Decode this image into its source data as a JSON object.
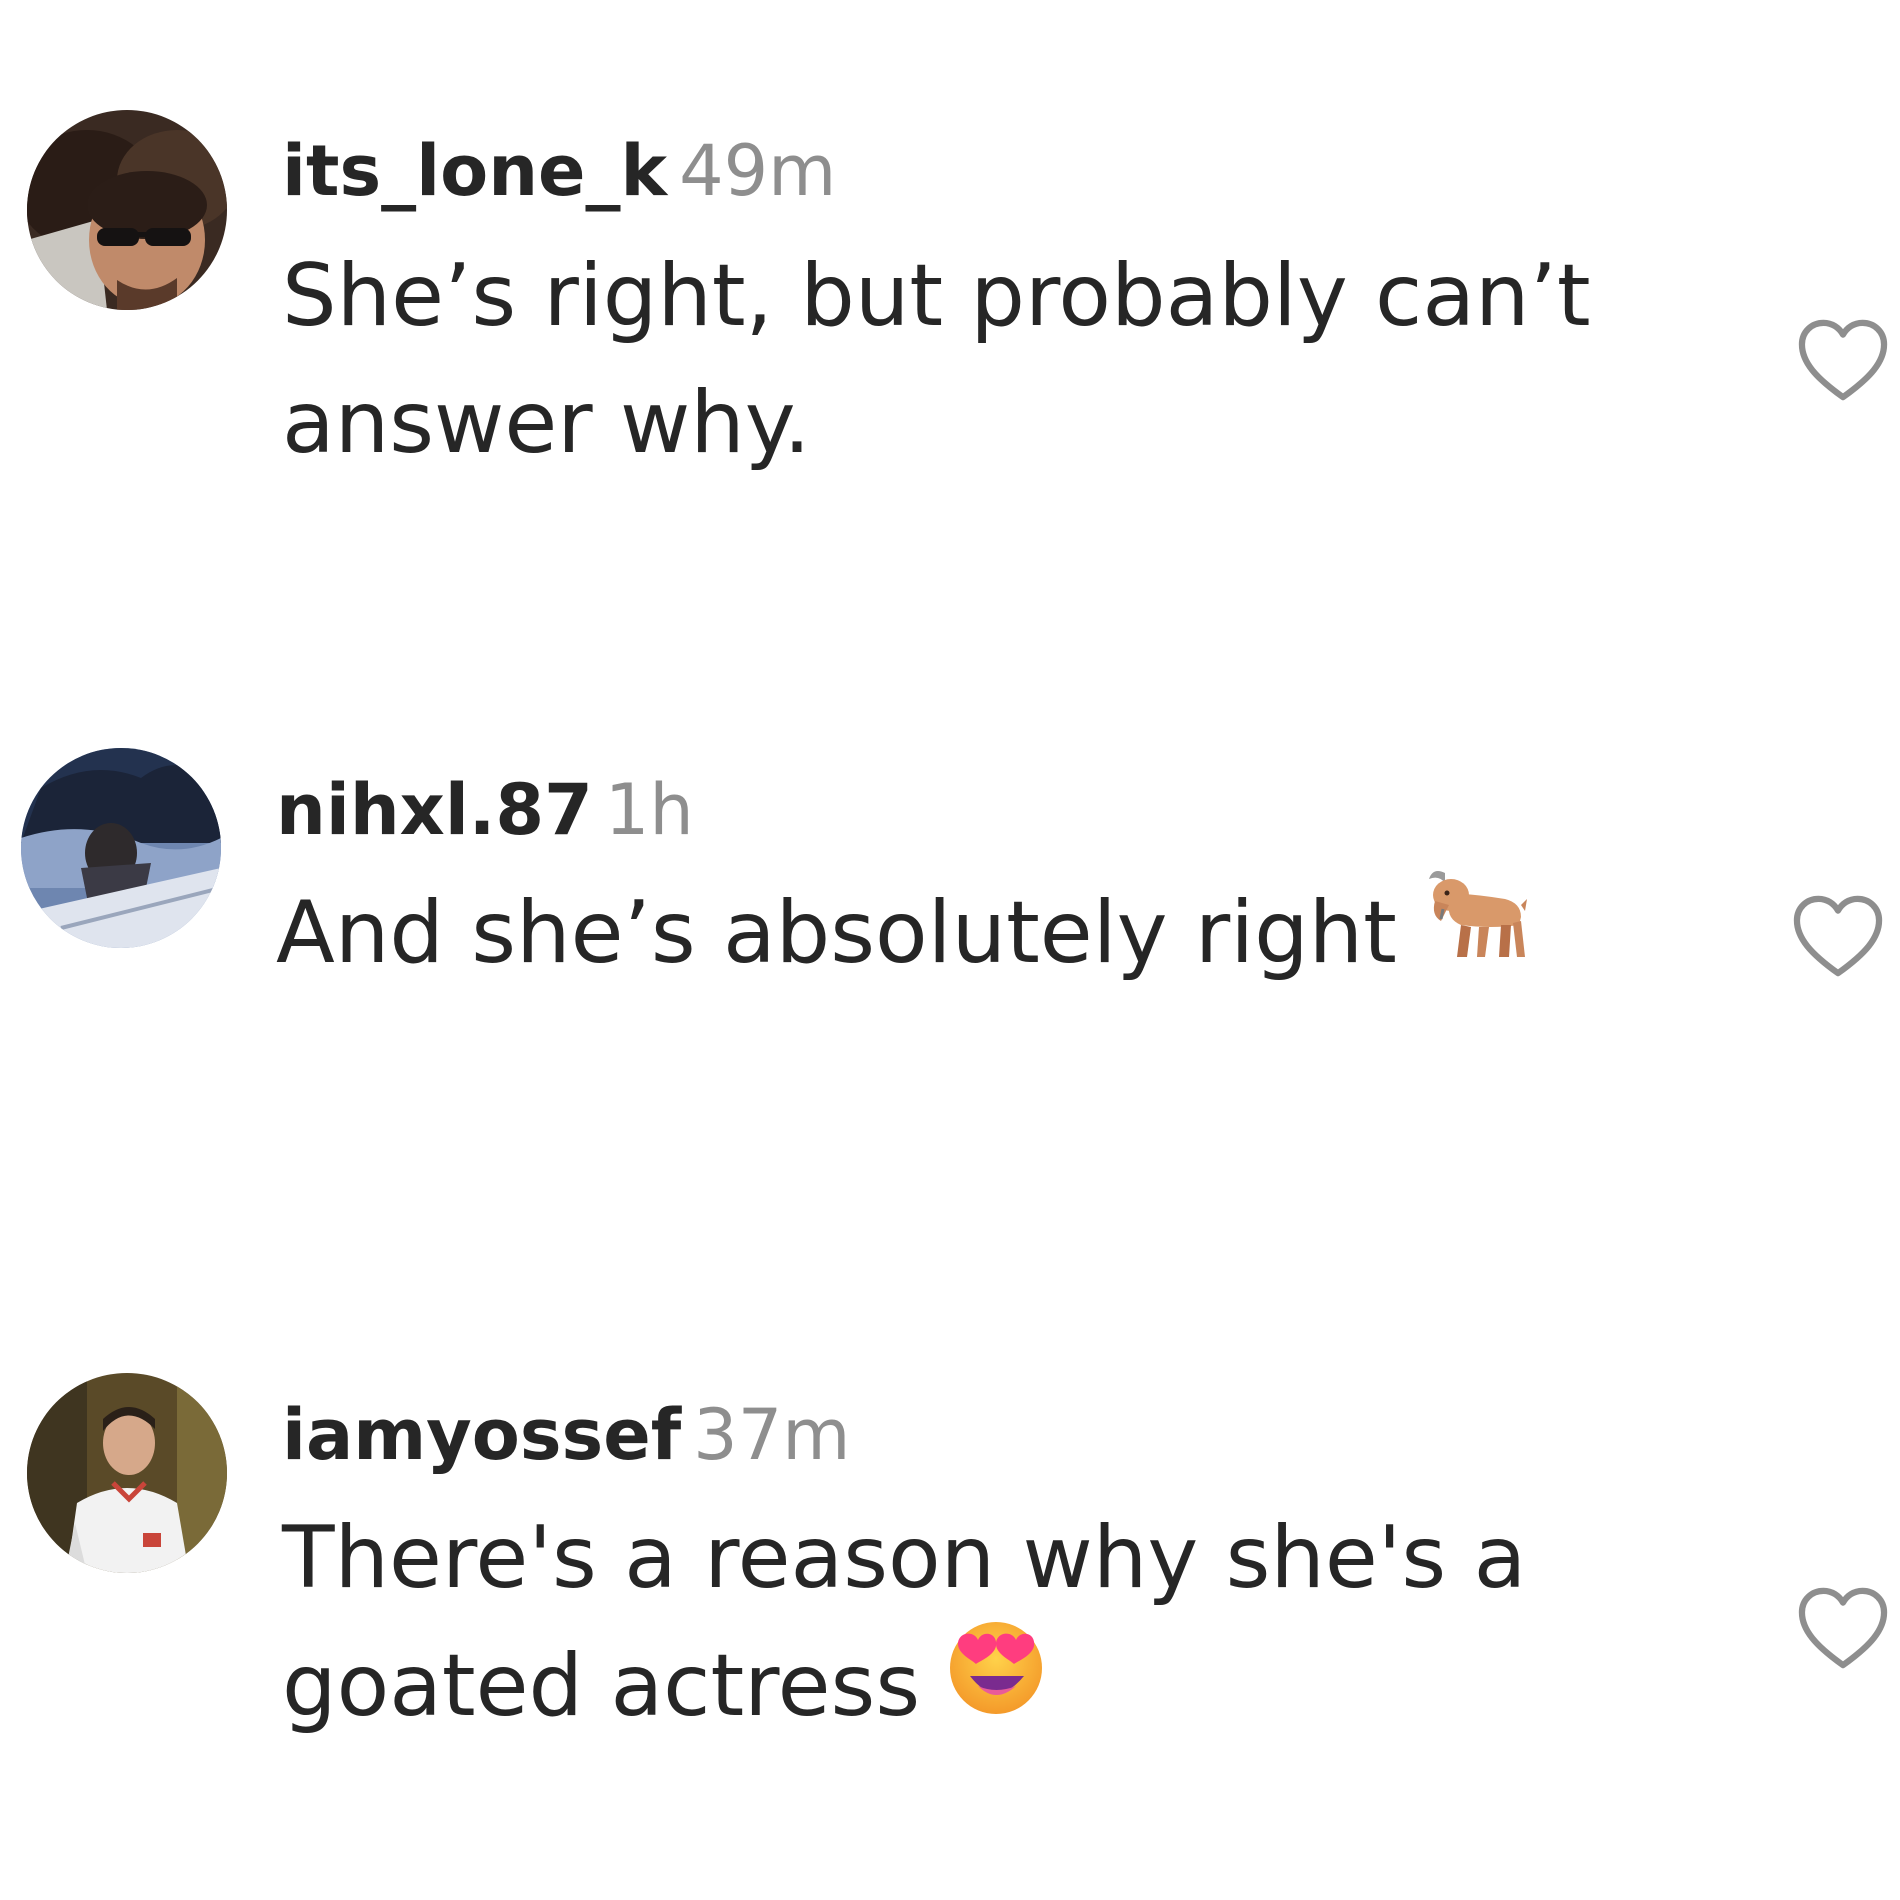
{
  "comments": [
    {
      "username": "its_lone_k",
      "time": "49m",
      "lines": [
        "She’s right, but probably can’t",
        "answer why."
      ],
      "emoji": "",
      "avatar_icon": "avatar-man-sunglasses"
    },
    {
      "username": "nihxl.87",
      "time": "1h",
      "lines": [
        "And she’s absolutely right"
      ],
      "emoji": "goat-icon",
      "avatar_icon": "avatar-car-window"
    },
    {
      "username": "iamyossef",
      "time": "37m",
      "lines": [
        "There's a reason why she's a",
        "goated actress"
      ],
      "emoji": "heart-eyes-face-icon",
      "avatar_icon": "avatar-person-white-shirt"
    }
  ],
  "colors": {
    "text": "#262626",
    "secondary_text": "#8e8e8e",
    "heart_outline": "#8e8e8e",
    "background": "#ffffff"
  }
}
